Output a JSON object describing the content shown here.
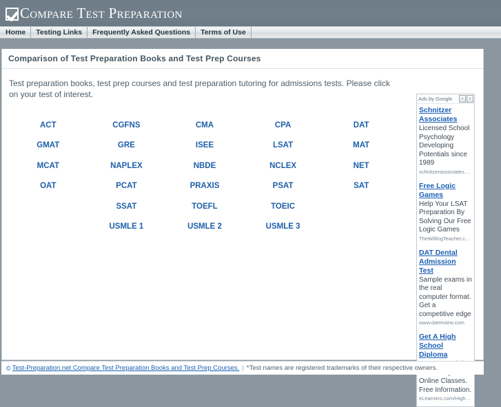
{
  "site": {
    "logo_text": "Compare Test Preparation",
    "logo_icon": "checkbox-check-icon"
  },
  "nav": {
    "items": [
      {
        "label": "Home"
      },
      {
        "label": "Testing Links"
      },
      {
        "label": "Frequently Asked Questions"
      },
      {
        "label": "Terms of Use"
      }
    ]
  },
  "page": {
    "title": "Comparison of Test Preparation Books and Test Prep Courses",
    "intro": "Test preparation books, test prep courses and test preparation tutoring for admissions tests. Please click on your test of interest."
  },
  "test_grid": {
    "rows": [
      [
        "ACT",
        "CGFNS",
        "CMA",
        "CPA",
        "DAT"
      ],
      [
        "GMAT",
        "GRE",
        "ISEE",
        "LSAT",
        "MAT"
      ],
      [
        "MCAT",
        "NAPLEX",
        "NBDE",
        "NCLEX",
        "NET"
      ],
      [
        "OAT",
        "PCAT",
        "PRAXIS",
        "PSAT",
        "SAT"
      ],
      [
        "",
        "SSAT",
        "TOEFL",
        "TOEIC",
        ""
      ],
      [
        "",
        "USMLE 1",
        "USMLE 2",
        "USMLE 3",
        ""
      ]
    ]
  },
  "ads": {
    "header_label": "Ads by Google",
    "prev_label": "‹",
    "next_label": "›",
    "units": [
      {
        "title": "Schnitzer Associates",
        "description": "Licensed School Psychology Developing Potentials since 1989",
        "url": "schnitzerassociates.c..."
      },
      {
        "title": "Free Logic Games",
        "description": "Help Your LSAT Preparation By Solving Our Free Logic Games",
        "url": "TheWillingTeacher.co..."
      },
      {
        "title": "DAT Dental Admission Test",
        "description": "Sample exams in the real computer format. Get a competitive edge",
        "url": "www.datreview.com"
      },
      {
        "title": "Get A High School Diploma",
        "description": "Earn Your High School Diploma! Online Classes. Free Information.",
        "url": "eLearners.com/HighS..."
      }
    ]
  },
  "footer": {
    "copyright_symbol": "©",
    "link_text": "Test-Preparation.net Compare Test Preparation Books and Test Prep Courses.",
    "separator": "|",
    "disclaimer": "*Test names are registered trademarks of their respective owners."
  },
  "colors": {
    "masthead_bg": "#6e7d88",
    "link_blue": "#1a5fb4",
    "page_bg": "#8b97a0",
    "text": "#4a5a66"
  }
}
